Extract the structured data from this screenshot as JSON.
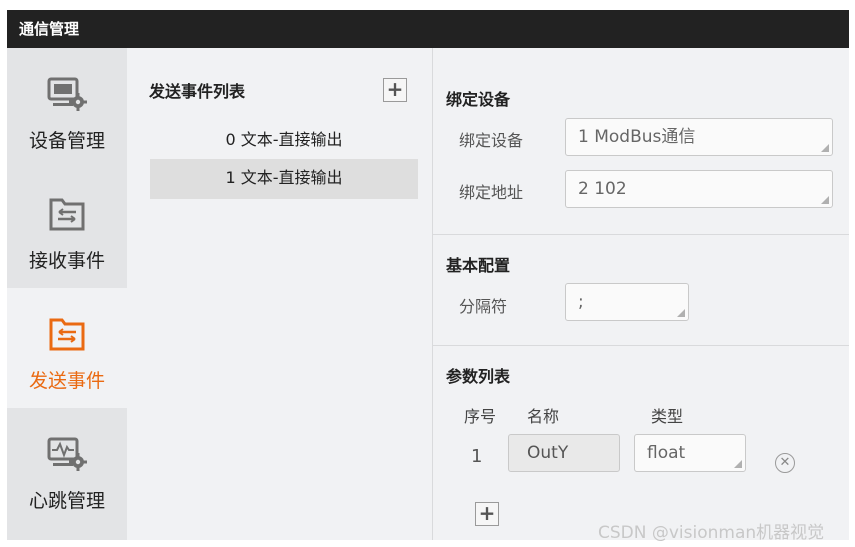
{
  "window": {
    "title": "通信管理"
  },
  "nav": [
    {
      "label": "设备管理",
      "icon": "device-settings-icon",
      "active": false
    },
    {
      "label": "接收事件",
      "icon": "receive-event-icon",
      "active": false
    },
    {
      "label": "发送事件",
      "icon": "send-event-icon",
      "active": true
    },
    {
      "label": "心跳管理",
      "icon": "heartbeat-settings-icon",
      "active": false
    }
  ],
  "list": {
    "title": "发送事件列表",
    "items": [
      {
        "label": "0 文本-直接输出",
        "selected": false
      },
      {
        "label": "1 文本-直接输出",
        "selected": true
      }
    ]
  },
  "bind_device": {
    "title": "绑定设备",
    "device_label": "绑定设备",
    "device_value": "1 ModBus通信",
    "address_label": "绑定地址",
    "address_value": "2 102"
  },
  "basic": {
    "title": "基本配置",
    "separator_label": "分隔符",
    "separator_value": ";"
  },
  "params": {
    "title": "参数列表",
    "col_index": "序号",
    "col_name": "名称",
    "col_type": "类型",
    "rows": [
      {
        "index": "1",
        "name": "OutY",
        "type": "float"
      }
    ]
  },
  "watermark": "CSDN @visionman机器视觉",
  "colors": {
    "accent": "#ea6a12",
    "titlebar": "#222222",
    "icon_gray": "#707070"
  }
}
